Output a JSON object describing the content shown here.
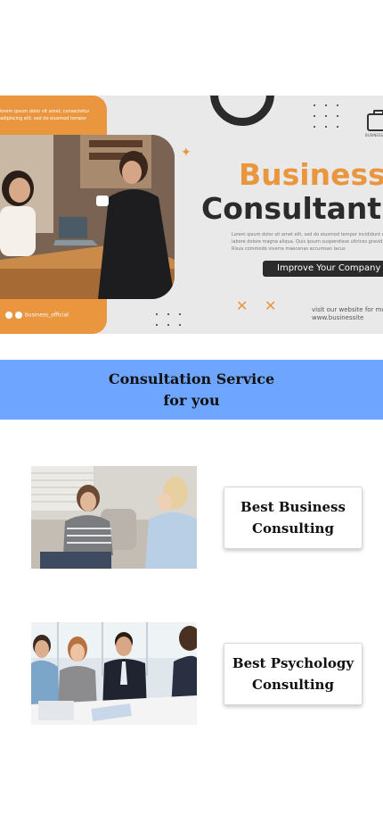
{
  "hero": {
    "lorem_top": "lorem ipsum dolor sit amet, consectetur adipiscing elit, sed do eiusmod tempor",
    "social_handle": "business_official",
    "bag_label": "BUSINESS",
    "title_line_1": "Business",
    "title_line_2": "Consultant",
    "description": "Lorem ipsum dolor sit amet elit, sed do eiusmod tempor incididunt ut labore dolore magna aliqua. Quis ipsum suspendisse ultrices gravida. Risus commodo viverra maecenas accumsan lacus",
    "cta_label": "Improve Your Company",
    "visit_line_1": "visit our website for more",
    "visit_line_2": "www.businessite",
    "accent_color": "#e9963f",
    "dark_color": "#2b2b2b"
  },
  "band": {
    "line_1": "Consultation Service",
    "line_2": "for you",
    "background_color": "#6ea6ff"
  },
  "services": [
    {
      "label_line_1": "Best Business",
      "label_line_2": "Consulting"
    },
    {
      "label_line_1": "Best Psychology",
      "label_line_2": "Consulting"
    }
  ]
}
